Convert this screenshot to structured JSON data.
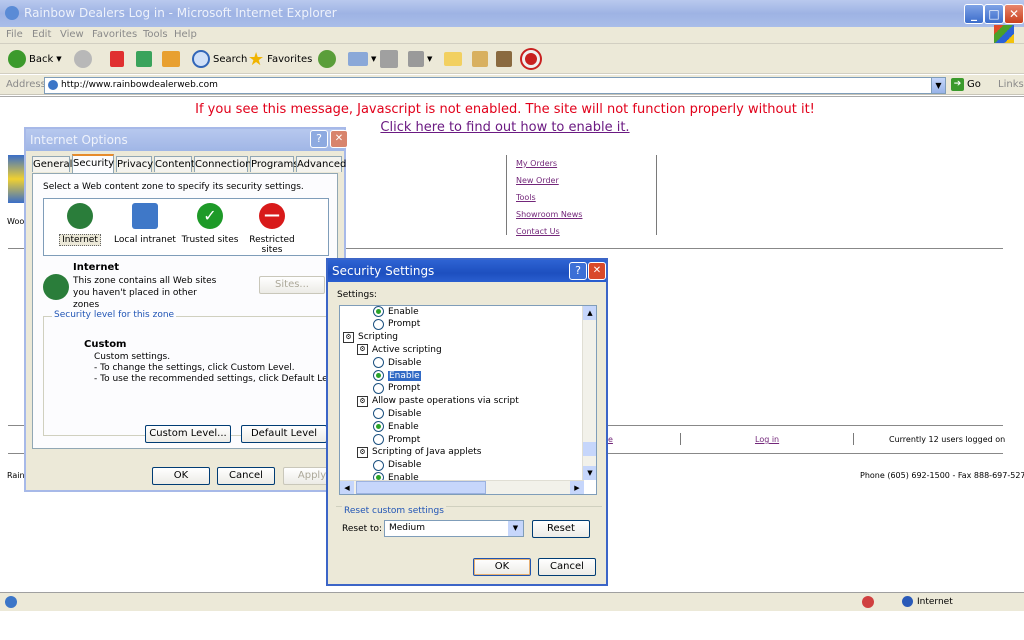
{
  "window": {
    "title": "Rainbow Dealers Log in - Microsoft Internet Explorer",
    "controls": {
      "minimize": "_",
      "maximize": "□",
      "close": "✕"
    }
  },
  "menu": [
    "File",
    "Edit",
    "View",
    "Favorites",
    "Tools",
    "Help"
  ],
  "toolbar": {
    "back": "Back",
    "search": "Search",
    "favorites": "Favorites"
  },
  "address": {
    "label": "Address",
    "url": "http://www.rainbowdealerweb.com",
    "go": "Go",
    "links": "Links"
  },
  "page": {
    "js_message": "If you see this message, Javascript is not enabled. The site will not function properly without it!",
    "js_link": "Click here to find out how to enable it.",
    "nav": [
      "My Orders",
      "New Order",
      "Tools",
      "Showroom News",
      "Contact Us"
    ],
    "left_fragment": "Woo",
    "rain_fragment": "Rain",
    "footer_fragment": "e",
    "login": "Log in",
    "users": "Currently 12 users logged on",
    "phone": "Phone (605) 692-1500 - Fax 888-697-5275"
  },
  "status": {
    "zone": "Internet"
  },
  "internet_options": {
    "title": "Internet Options",
    "help": "?",
    "close": "✕",
    "tabs": [
      "General",
      "Security",
      "Privacy",
      "Content",
      "Connections",
      "Programs",
      "Advanced"
    ],
    "select_text": "Select a Web content zone to specify its security settings.",
    "zones": [
      {
        "label": "Internet",
        "color": "#2a7d3a"
      },
      {
        "label": "Local intranet",
        "color": "#3f78c8"
      },
      {
        "label": "Trusted sites",
        "color": "#1e9a28"
      },
      {
        "label": "Restricted sites",
        "color": "#d81a1a"
      }
    ],
    "zone_title": "Internet",
    "zone_desc": "This zone contains all Web sites you haven't placed in other zones",
    "sites_button": "Sites...",
    "security_level": "Security level for this zone",
    "custom_title": "Custom",
    "custom_line1": "Custom settings.",
    "custom_line2": "- To change the settings, click Custom Level.",
    "custom_line3": "- To use the recommended settings, click Default Level.",
    "custom_level_button": "Custom Level...",
    "default_level_button": "Default Level",
    "ok": "OK",
    "cancel": "Cancel",
    "apply": "Apply"
  },
  "security_settings": {
    "title": "Security Settings",
    "help": "?",
    "close": "✕",
    "settings_label": "Settings:",
    "rows": [
      {
        "text": "Enable",
        "type": "radio",
        "checked": true,
        "level": 2
      },
      {
        "text": "Prompt",
        "type": "radio",
        "checked": false,
        "level": 2
      },
      {
        "text": "Scripting",
        "type": "group",
        "level": 0
      },
      {
        "text": "Active scripting",
        "type": "group",
        "level": 1
      },
      {
        "text": "Disable",
        "type": "radio",
        "checked": false,
        "level": 2
      },
      {
        "text": "Enable",
        "type": "radio",
        "checked": true,
        "level": 2,
        "selected": true
      },
      {
        "text": "Prompt",
        "type": "radio",
        "checked": false,
        "level": 2
      },
      {
        "text": "Allow paste operations via script",
        "type": "group",
        "level": 1
      },
      {
        "text": "Disable",
        "type": "radio",
        "checked": false,
        "level": 2
      },
      {
        "text": "Enable",
        "type": "radio",
        "checked": true,
        "level": 2
      },
      {
        "text": "Prompt",
        "type": "radio",
        "checked": false,
        "level": 2
      },
      {
        "text": "Scripting of Java applets",
        "type": "group",
        "level": 1
      },
      {
        "text": "Disable",
        "type": "radio",
        "checked": false,
        "level": 2
      },
      {
        "text": "Enable",
        "type": "radio",
        "checked": true,
        "level": 2
      }
    ],
    "reset_title": "Reset custom settings",
    "reset_to": "Reset to:",
    "reset_value": "Medium",
    "reset_button": "Reset",
    "ok": "OK",
    "cancel": "Cancel"
  }
}
